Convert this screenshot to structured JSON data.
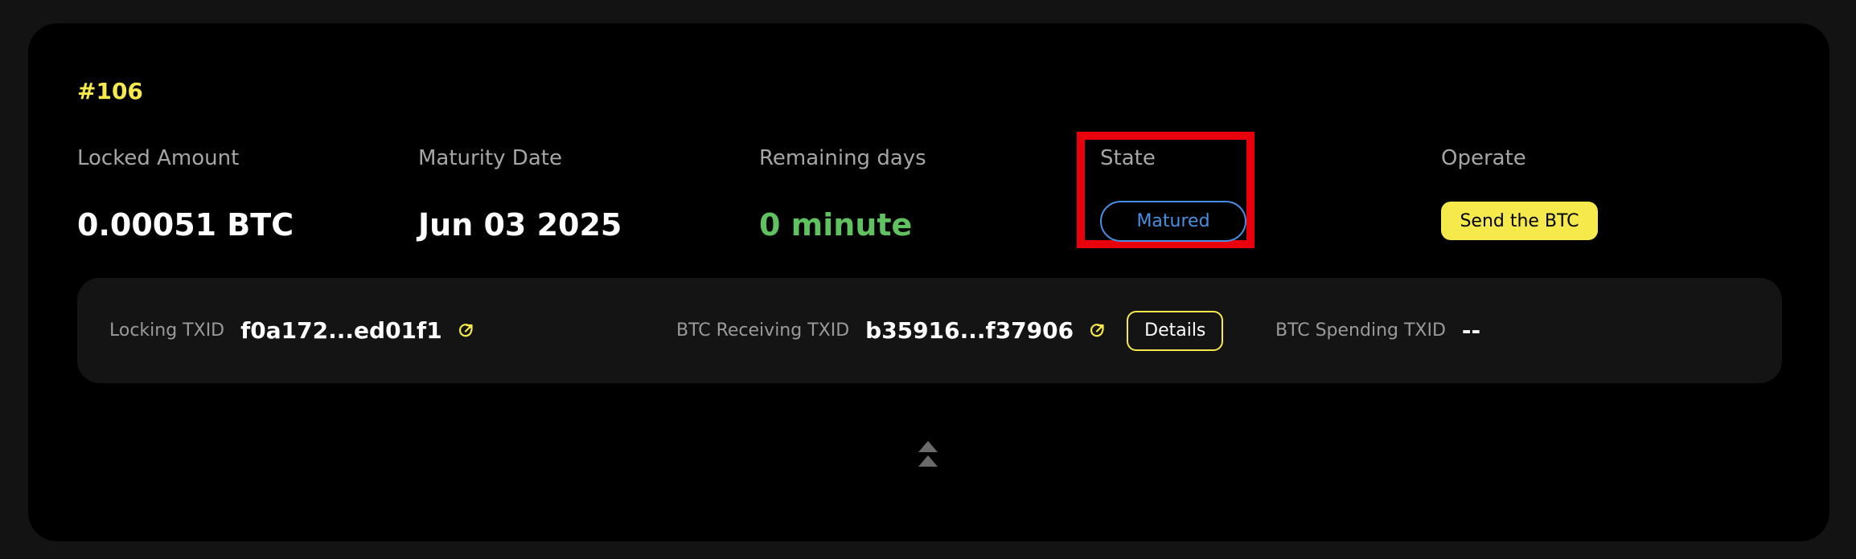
{
  "card": {
    "id": "#106",
    "locked_amount": {
      "label": "Locked Amount",
      "value": "0.00051 BTC"
    },
    "maturity_date": {
      "label": "Maturity Date",
      "value": "Jun 03 2025"
    },
    "remaining_days": {
      "label": "Remaining days",
      "value": "0 minute"
    },
    "state": {
      "label": "State",
      "value": "Matured"
    },
    "operate": {
      "label": "Operate",
      "button": "Send the BTC"
    }
  },
  "txids": {
    "locking": {
      "label": "Locking TXID",
      "value": "f0a172...ed01f1"
    },
    "receiving": {
      "label": "BTC Receiving TXID",
      "value": "b35916...f37906",
      "details_button": "Details"
    },
    "spending": {
      "label": "BTC Spending TXID",
      "value": "--"
    }
  },
  "icons": {
    "external_link": "external-link-icon",
    "collapse": "double-chevron-up-icon"
  },
  "colors": {
    "accent_yellow": "#f5e94b",
    "remaining_green": "#5fc15f",
    "state_blue": "#4a90e2",
    "highlight_red": "#e8000d"
  }
}
